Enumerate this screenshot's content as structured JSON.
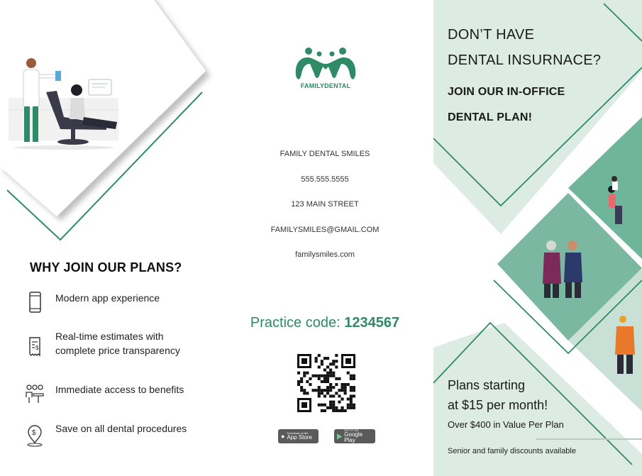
{
  "left_panel": {
    "why_title": "WHY JOIN OUR PLANS?",
    "benefits": [
      {
        "icon": "phone-icon",
        "text": "Modern app experience"
      },
      {
        "icon": "receipt-icon",
        "text": "Real-time estimates with complete price transparency"
      },
      {
        "icon": "people-meeting-icon",
        "text": "Immediate access to benefits"
      },
      {
        "icon": "dollar-location-icon",
        "text": "Save on all dental procedures"
      }
    ]
  },
  "middle_panel": {
    "logo_text": "FAMILYDENTAL",
    "contact": {
      "name": "FAMILY DENTAL SMILES",
      "phone": "555.555.5555",
      "address": "123 MAIN STREET",
      "email": "FAMILYSMILES@GMAIL.COM",
      "website": "familysmiles.com"
    },
    "practice_label": "Practice code:",
    "practice_code": "1234567",
    "app_store": {
      "small": "Download on the",
      "big": "App Store"
    },
    "google_play": {
      "small": "GET IT ON",
      "big": "Google Play"
    }
  },
  "right_panel": {
    "heading_line1": "DON’T HAVE",
    "heading_line2": "DENTAL INSURNACE?",
    "sub_line1": "JOIN OUR IN-OFFICE",
    "sub_line2": "DENTAL PLAN!",
    "plans_line1": "Plans starting",
    "plans_line2": "at $15 per month!",
    "value_line": "Over $400 in Value Per Plan",
    "discount_line": "Senior and family discounts available"
  },
  "colors": {
    "brand_green": "#2e8a67",
    "light_mint": "#dcebe4",
    "mid_teal": "#6fb59b",
    "dark_teal": "#3f9a7c"
  }
}
